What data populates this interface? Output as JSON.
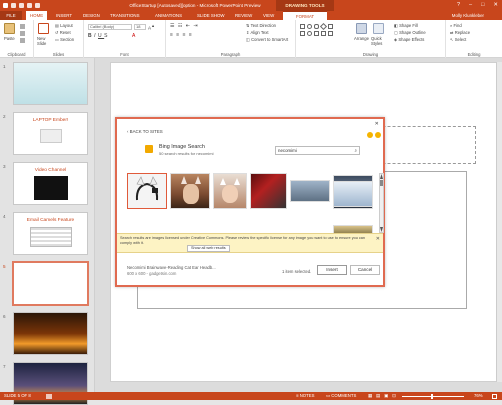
{
  "titlebar": {
    "title": "OfficeStartup [Autosaved][option - Microsoft PowerPoint Preview",
    "tools_label": "DRAWING TOOLS",
    "minimize": "–",
    "restore": "□",
    "close": "✕"
  },
  "tabs": {
    "file": "FILE",
    "items": [
      "HOME",
      "INSERT",
      "DESIGN",
      "TRANSITIONS",
      "ANIMATIONS",
      "SLIDE SHOW",
      "REVIEW",
      "VIEW"
    ],
    "format": "FORMAT",
    "user": "Molly Klunkleber"
  },
  "ribbon": {
    "paste": "Paste",
    "clipboard": "Clipboard",
    "new_slide": "New Slide",
    "layout": "Layout",
    "reset": "Reset",
    "section": "Section",
    "slides": "Slides",
    "font_name": "Calibri (Body)",
    "font_size": "18",
    "font": "Font",
    "text_direction": "Text Direction",
    "align_text": "Align Text",
    "convert_smartart": "Convert to SmartArt",
    "paragraph": "Paragraph",
    "arrange": "Arrange",
    "quick_styles": "Quick Styles",
    "shape_fill": "Shape Fill",
    "shape_outline": "Shape Outline",
    "shape_effects": "Shape Effects",
    "drawing": "Drawing",
    "find": "Find",
    "replace": "Replace",
    "select": "Select",
    "editing": "Editing"
  },
  "thumbnails": [
    {
      "num": "1",
      "title": ""
    },
    {
      "num": "2",
      "title": "LAPTOP Ember!"
    },
    {
      "num": "3",
      "title": "Video Channel"
    },
    {
      "num": "4",
      "title": "Email Camels Feature"
    },
    {
      "num": "5",
      "title": ""
    },
    {
      "num": "6",
      "title": ""
    },
    {
      "num": "7",
      "title": ""
    }
  ],
  "dialog": {
    "back": "‹ BACK TO SITES",
    "title": "Bing Image Search",
    "subtitle": "50 search results for necomimi",
    "search_value": "necomimi",
    "notice": "Search results are images licensed under Creative Commons. Please review the specific license for any image you want to use to ensure you can comply with it.",
    "show_all": "Show all web results",
    "selected_name": "Necomimi Brainwave-Reading Cat Ear Headb...",
    "selected_meta": "600 x 600 - gadgetsin.com",
    "count": "1 item selected.",
    "insert": "Insert",
    "cancel": "Cancel",
    "close": "✕"
  },
  "status": {
    "slide": "SLIDE 5 OF 8",
    "notes": "NOTES",
    "comments": "COMMENTS",
    "zoom": "76%"
  }
}
